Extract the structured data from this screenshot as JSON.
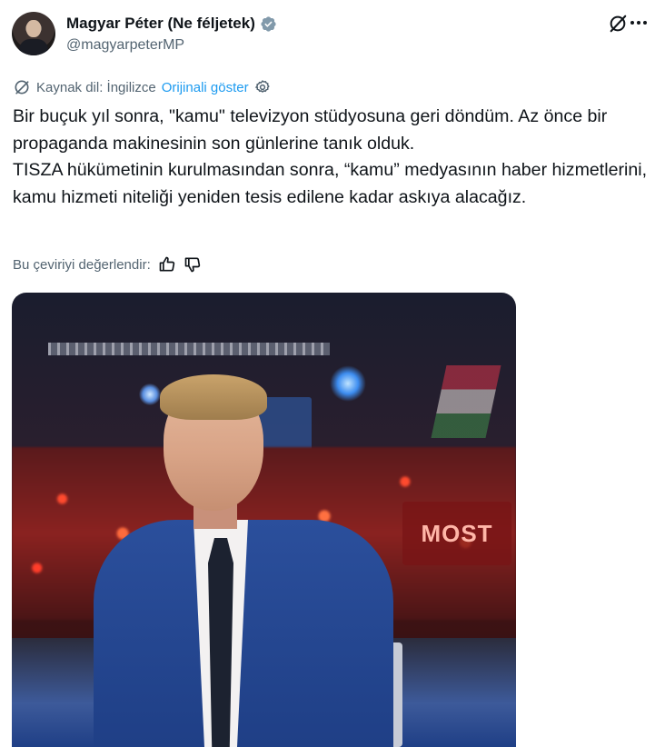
{
  "author": {
    "display_name": "Magyar Péter (Ne féljetek)",
    "handle": "@magyarpeterMP",
    "verified": true
  },
  "icons": {
    "grok": "grok-icon",
    "more": "more-icon",
    "translate": "translate-icon",
    "settings": "settings-icon",
    "thumbs_up": "thumbs-up-icon",
    "thumbs_down": "thumbs-down-icon",
    "verified": "verified-badge-icon"
  },
  "translation": {
    "source_label": "Kaynak dil: İngilizce",
    "show_original": "Orijinali göster"
  },
  "tweet": {
    "paragraph_1": "Bir buçuk yıl sonra, \"kamu\" televizyon stüdyosuna geri döndüm. Az önce bir propaganda makinesinin son günlerine tanık olduk.",
    "paragraph_2": "TISZA hükümetinin kurulmasından sonra, “kamu” medyasının haber hizmetlerini, kamu hizmeti niteliği yeniden tesis edilene kadar askıya alacağız."
  },
  "rate": {
    "label": "Bu çeviriyi değerlendir:"
  },
  "media": {
    "sign_text": "MOST"
  },
  "colors": {
    "accent": "#1d9bf0",
    "text": "#0f1419",
    "secondary": "#536471"
  }
}
